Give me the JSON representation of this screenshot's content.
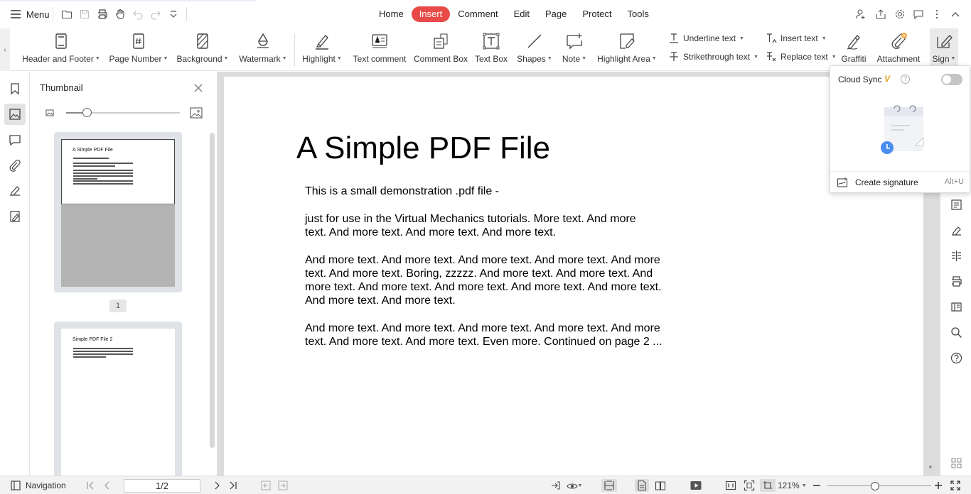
{
  "topbar": {
    "menu_label": "Menu",
    "tabs": [
      {
        "label": "Home",
        "active": false
      },
      {
        "label": "Insert",
        "active": true
      },
      {
        "label": "Comment",
        "active": false
      },
      {
        "label": "Edit",
        "active": false
      },
      {
        "label": "Page",
        "active": false
      },
      {
        "label": "Protect",
        "active": false
      },
      {
        "label": "Tools",
        "active": false
      }
    ],
    "accent_color": "#e84b47"
  },
  "ribbon": {
    "tools": [
      {
        "label": "Header and Footer",
        "dropdown": true,
        "icon": "header-footer-icon"
      },
      {
        "label": "Page Number",
        "dropdown": true,
        "icon": "page-number-icon"
      },
      {
        "label": "Background",
        "dropdown": true,
        "icon": "background-icon"
      },
      {
        "label": "Watermark",
        "dropdown": true,
        "icon": "watermark-icon"
      },
      {
        "label": "Highlight",
        "dropdown": true,
        "icon": "highlight-icon"
      },
      {
        "label": "Text comment",
        "dropdown": false,
        "icon": "text-comment-icon"
      },
      {
        "label": "Comment Box",
        "dropdown": false,
        "icon": "comment-box-icon"
      },
      {
        "label": "Text Box",
        "dropdown": false,
        "icon": "text-box-icon"
      },
      {
        "label": "Shapes",
        "dropdown": true,
        "icon": "shapes-icon"
      },
      {
        "label": "Note",
        "dropdown": true,
        "icon": "note-icon"
      },
      {
        "label": "Highlight Area",
        "dropdown": true,
        "icon": "highlight-area-icon"
      },
      {
        "label": "Graffiti",
        "dropdown": false,
        "icon": "graffiti-icon"
      },
      {
        "label": "Attachment",
        "dropdown": false,
        "icon": "attachment-icon"
      },
      {
        "label": "Sign",
        "dropdown": true,
        "icon": "sign-icon"
      }
    ],
    "small_tools": [
      {
        "label": "Underline text",
        "icon": "underline-icon"
      },
      {
        "label": "Strikethrough text",
        "icon": "strikethrough-icon"
      },
      {
        "label": "Insert text",
        "icon": "insert-text-icon"
      },
      {
        "label": "Replace text",
        "icon": "replace-text-icon"
      }
    ]
  },
  "thumbnail_panel": {
    "title": "Thumbnail",
    "zoom_level": 0.18,
    "pages": [
      {
        "number": "1",
        "title": "A Simple PDF File"
      },
      {
        "title": "Simple PDF File 2"
      }
    ]
  },
  "document": {
    "title": "A Simple PDF File",
    "paragraphs": [
      [
        "This is a small demonstration .pdf file -"
      ],
      [
        "just for use in the Virtual Mechanics tutorials. More text. And more",
        "text. And more text. And more text. And more text."
      ],
      [
        "And more text. And more text. And more text. And more text. And more",
        "text. And more text. Boring, zzzzz. And more text. And more text. And",
        "more text. And more text. And more text. And more text. And more text.",
        "And more text. And more text."
      ],
      [
        "And more text. And more text. And more text. And more text. And more",
        "text. And more text. And more text. Even more. Continued on page 2 ..."
      ]
    ]
  },
  "sign_popup": {
    "cloud_sync_label": "Cloud Sync",
    "vip_badge": "V",
    "help": "?",
    "cloud_sync_enabled": false,
    "create_label": "Create signature",
    "shortcut": "Alt+U"
  },
  "statusbar": {
    "navigation_label": "Navigation",
    "page_value": "1/2",
    "zoom": "121%",
    "zoom_fraction": 0.46
  }
}
